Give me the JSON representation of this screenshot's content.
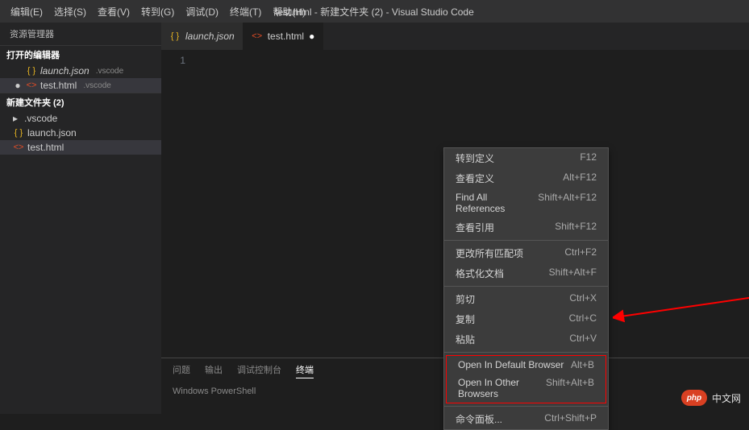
{
  "menubar": {
    "items": [
      {
        "label": "编辑(E)"
      },
      {
        "label": "选择(S)"
      },
      {
        "label": "查看(V)"
      },
      {
        "label": "转到(G)"
      },
      {
        "label": "调试(D)"
      },
      {
        "label": "终端(T)"
      },
      {
        "label": "帮助(H)"
      }
    ],
    "title": "test.html - 新建文件夹 (2) - Visual Studio Code"
  },
  "sidebar": {
    "title": "资源管理器",
    "open_editors_header": "打开的编辑器",
    "open_editors": [
      {
        "name": "launch.json",
        "hint": ".vscode",
        "icon": "json",
        "dirty": false,
        "italic": true
      },
      {
        "name": "test.html",
        "hint": ".vscode",
        "icon": "html",
        "dirty": true,
        "selected": true
      }
    ],
    "folder_header": "新建文件夹 (2)",
    "tree": [
      {
        "name": ".vscode",
        "type": "folder"
      },
      {
        "name": "launch.json",
        "type": "file",
        "icon": "json"
      },
      {
        "name": "test.html",
        "type": "file",
        "icon": "html",
        "selected": true
      }
    ]
  },
  "tabs": [
    {
      "name": "launch.json",
      "icon": "json",
      "dirty": false,
      "italic": true
    },
    {
      "name": "test.html",
      "icon": "html",
      "dirty": true,
      "active": true
    }
  ],
  "editor": {
    "line_number": "1"
  },
  "context_menu": {
    "groups": [
      [
        {
          "label": "转到定义",
          "key": "F12"
        },
        {
          "label": "查看定义",
          "key": "Alt+F12"
        },
        {
          "label": "Find All References",
          "key": "Shift+Alt+F12"
        },
        {
          "label": "查看引用",
          "key": "Shift+F12"
        }
      ],
      [
        {
          "label": "更改所有匹配项",
          "key": "Ctrl+F2"
        },
        {
          "label": "格式化文档",
          "key": "Shift+Alt+F"
        }
      ],
      [
        {
          "label": "剪切",
          "key": "Ctrl+X"
        },
        {
          "label": "复制",
          "key": "Ctrl+C"
        },
        {
          "label": "粘贴",
          "key": "Ctrl+V"
        }
      ],
      [
        {
          "label": "Open In Default Browser",
          "key": "Alt+B",
          "highlight": true
        },
        {
          "label": "Open In Other Browsers",
          "key": "Shift+Alt+B",
          "highlight": true
        }
      ],
      [
        {
          "label": "命令面板...",
          "key": "Ctrl+Shift+P"
        }
      ]
    ]
  },
  "panel": {
    "tabs": [
      "问题",
      "输出",
      "调试控制台",
      "终端"
    ],
    "active_tab": 3,
    "content": "Windows PowerShell"
  },
  "watermark": {
    "logo_text": "php",
    "text": "中文网"
  }
}
